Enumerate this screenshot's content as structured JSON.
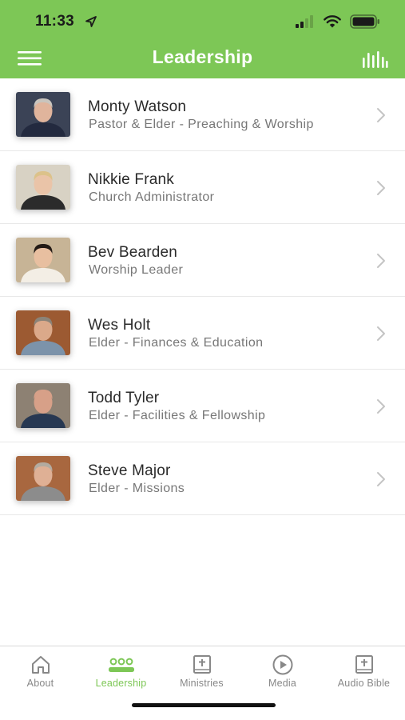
{
  "status_bar": {
    "time": "11:33"
  },
  "header": {
    "title": "Leadership"
  },
  "colors": {
    "accent": "#7dc756",
    "inactive": "#888888"
  },
  "leaders": [
    {
      "name": "Monty Watson",
      "role": "Pastor & Elder - Preaching & Worship",
      "photo": {
        "bg": "#3b4356",
        "skin": "#e0b49c",
        "hair": "#c9c4bd",
        "shirt": "#232a3f"
      }
    },
    {
      "name": "Nikkie Frank",
      "role": "Church Administrator",
      "photo": {
        "bg": "#d8d2c4",
        "skin": "#eac4a8",
        "hair": "#dcc28a",
        "shirt": "#2b2b2b"
      }
    },
    {
      "name": "Bev Bearden",
      "role": "Worship Leader",
      "photo": {
        "bg": "#c7b496",
        "skin": "#e8bfa0",
        "hair": "#231a15",
        "shirt": "#f3eee5"
      }
    },
    {
      "name": "Wes Holt",
      "role": "Elder - Finances & Education",
      "photo": {
        "bg": "#9c5a32",
        "skin": "#dba98a",
        "hair": "#8b8378",
        "shirt": "#7c93aa"
      }
    },
    {
      "name": "Todd Tyler",
      "role": "Elder - Facilities & Fellowship",
      "photo": {
        "bg": "#8d8173",
        "skin": "#d7a088",
        "hair": "#d7a088",
        "shirt": "#273852"
      }
    },
    {
      "name": "Steve Major",
      "role": "Elder - Missions",
      "photo": {
        "bg": "#a8673f",
        "skin": "#dfb095",
        "hair": "#b3aba0",
        "shirt": "#8c8c8c"
      }
    }
  ],
  "tabs": [
    {
      "label": "About",
      "icon": "home-icon",
      "active": false
    },
    {
      "label": "Leadership",
      "icon": "group-icon",
      "active": true
    },
    {
      "label": "Ministries",
      "icon": "bible-icon",
      "active": false
    },
    {
      "label": "Media",
      "icon": "play-icon",
      "active": false
    },
    {
      "label": "Audio Bible",
      "icon": "bible-icon",
      "active": false
    }
  ]
}
